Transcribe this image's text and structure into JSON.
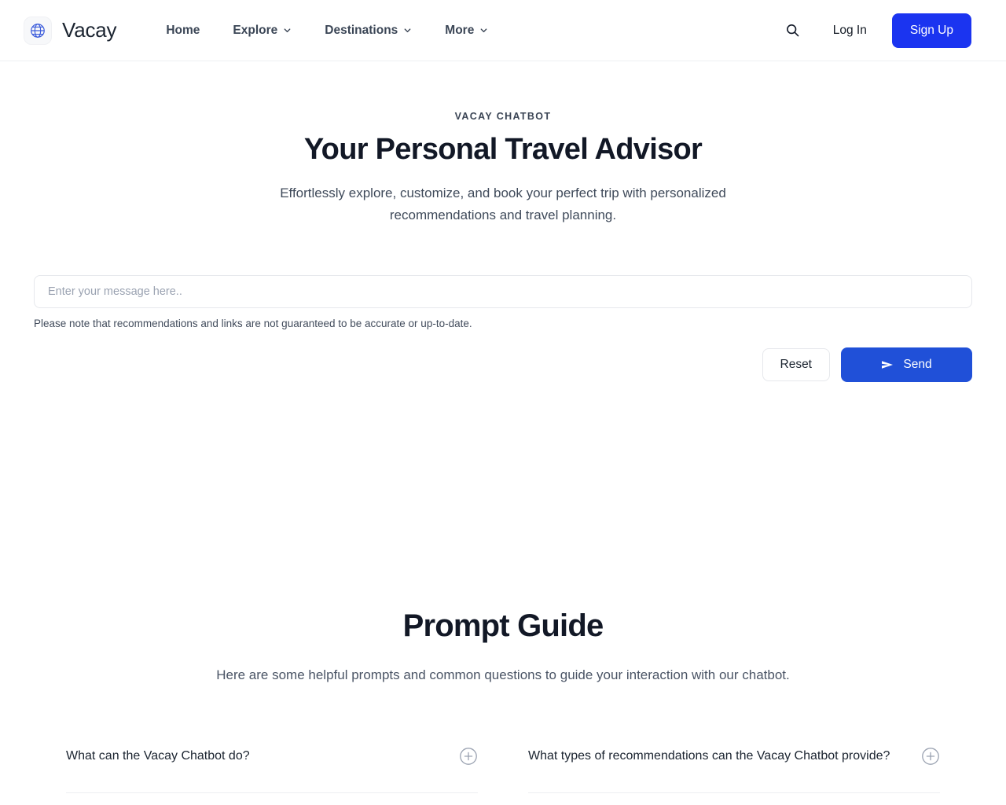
{
  "header": {
    "brand": {
      "name": "Vacay",
      "logo_icon": "globe-icon",
      "accent": "#1b34f0"
    },
    "nav": [
      {
        "label": "Home",
        "has_dropdown": false
      },
      {
        "label": "Explore",
        "has_dropdown": true
      },
      {
        "label": "Destinations",
        "has_dropdown": true
      },
      {
        "label": "More",
        "has_dropdown": true
      }
    ],
    "search_icon": "search-icon",
    "login_label": "Log In",
    "signup_label": "Sign Up"
  },
  "hero": {
    "eyebrow": "VACAY CHATBOT",
    "title": "Your Personal Travel Advisor",
    "subtitle": "Effortlessly explore, customize, and book your perfect trip with personalized recommendations and travel planning."
  },
  "chat": {
    "input_value": "",
    "input_placeholder": "Enter your message here..",
    "disclaimer": "Please note that recommendations and links are not guaranteed to be accurate or up-to-date.",
    "reset_label": "Reset",
    "send_label": "Send",
    "send_icon": "paper-plane-icon",
    "send_color": "#2050d8"
  },
  "guide": {
    "title": "Prompt Guide",
    "subtitle": "Here are some helpful prompts and common questions to guide your interaction with our chatbot.",
    "faqs": [
      {
        "question": "What can the Vacay Chatbot do?",
        "toggle_icon": "plus-circle-icon",
        "expanded": false
      },
      {
        "question": "What types of recommendations can the Vacay Chatbot provide?",
        "toggle_icon": "plus-circle-icon",
        "expanded": false
      }
    ]
  }
}
